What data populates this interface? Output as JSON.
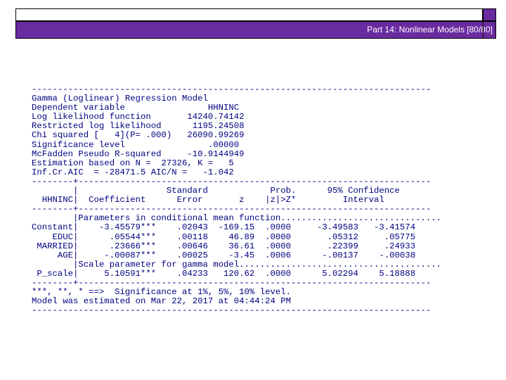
{
  "slide": {
    "title": "Part 14: Nonlinear Models [80/80]"
  },
  "output": {
    "lines": [
      "-----------------------------------------------------------------------------",
      "Gamma (Loglinear) Regression Model",
      "Dependent variable                HHNINC",
      "Log likelihood function       14240.74142",
      "Restricted log likelihood      1195.24508",
      "Chi squared [   4](P= .000)   26090.99269",
      "Significance level                .00000",
      "McFadden Pseudo R-squared     -10.9144949",
      "Estimation based on N =  27326, K =   5",
      "Inf.Cr.AIC  = -28471.5 AIC/N =   -1.042",
      "--------+--------------------------------------------------------------------",
      "        |                 Standard            Prob.      95% Confidence",
      "  HHNINC|  Coefficient      Error       z    |z|>Z*         Interval",
      "--------+--------------------------------------------------------------------",
      "        |Parameters in conditional mean function...............................",
      "Constant|    -3.45579***    .02043  -169.15  .0000     -3.49583   -3.41574",
      "    EDUC|      .05544***    .00118    46.89  .0000       .05312     .05775",
      " MARRIED|      .23666***    .00646    36.61  .0000       .22399     .24933",
      "     AGE|     -.00087***    .00025    -3.45  .0006      -.00137    -.00038",
      "        |Scale parameter for gamma model.......................................",
      " P_scale|     5.10591***    .04233   120.62  .0000      5.02294    5.18888",
      "--------+--------------------------------------------------------------------",
      "***, **, * ==>  Significance at 1%, 5%, 10% level.",
      "Model was estimated on Mar 22, 2017 at 04:44:24 PM",
      "-----------------------------------------------------------------------------"
    ]
  }
}
